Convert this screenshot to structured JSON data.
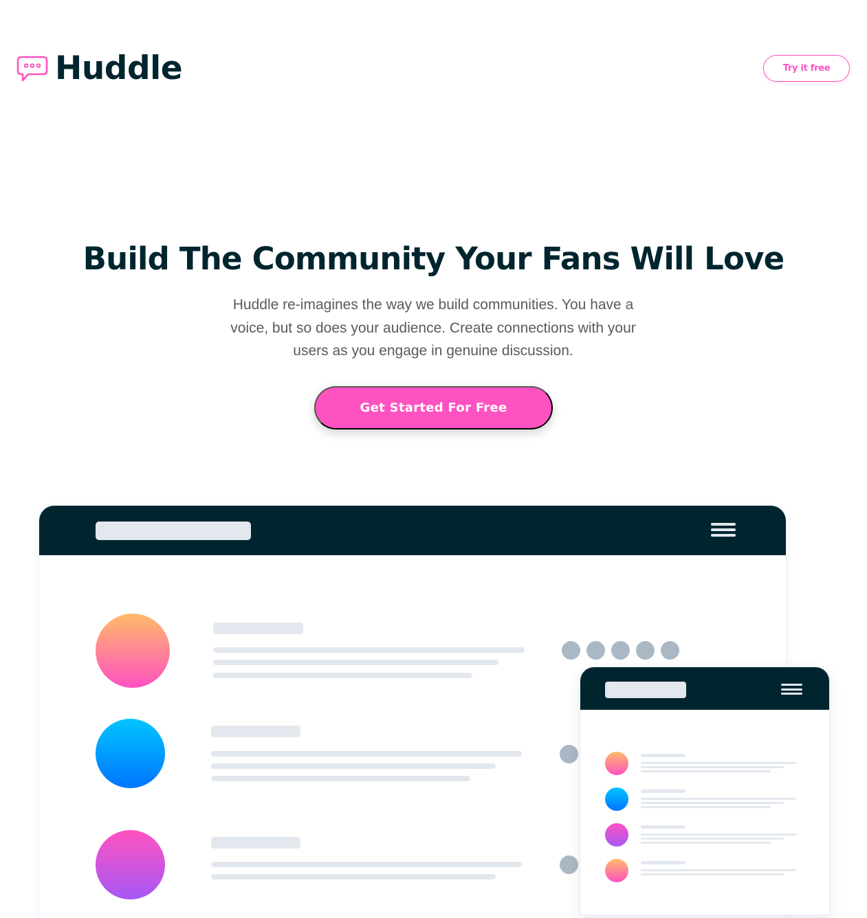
{
  "header": {
    "logo_text": "Huddle",
    "cta_label": "Try it free"
  },
  "hero": {
    "title": "Build The Community Your Fans Will Love",
    "description": "Huddle re-imagines the way we build communities. You have a voice, but so does your audience. Create connections with your users as you engage in genuine discussion.",
    "cta_label": "Get Started For Free"
  },
  "colors": {
    "brand_dark": "#00252e",
    "accent_pink": "#ff52c1",
    "body_text": "#5a5a5a",
    "placeholder_gray": "#e2e8ee",
    "dot_gray": "#aab7c4"
  },
  "icons": {
    "logo": "chat-bubble-icon",
    "menu": "hamburger-menu-icon"
  }
}
